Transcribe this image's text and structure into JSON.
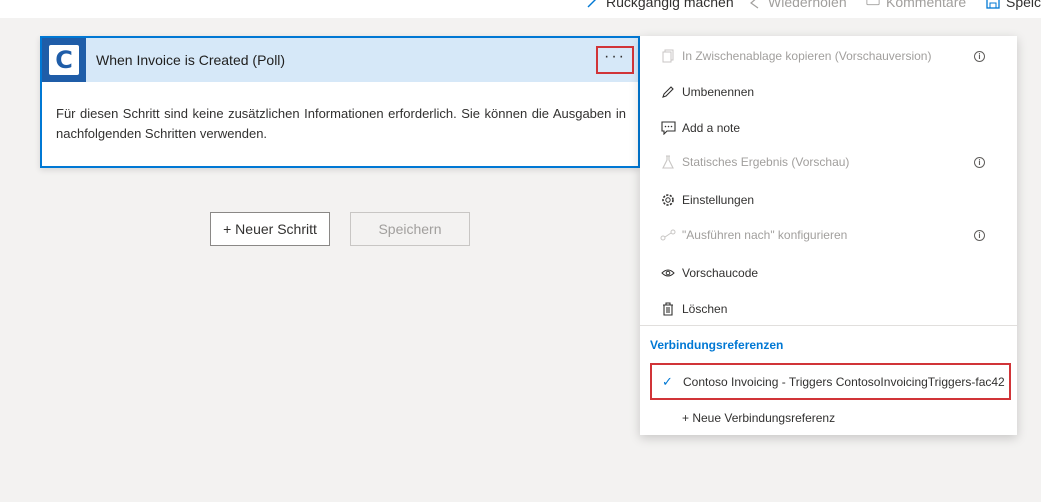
{
  "toolbar": {
    "undo_label": "Rückgängig machen",
    "redo_label": "Wiederholen",
    "comments_label": "Kommentare",
    "save_label": "Speichern",
    "undo_icon": "undo-arrow-icon",
    "redo_icon": "redo-arrow-icon",
    "comments_icon": "comment-icon",
    "save_icon": "save-disk-icon"
  },
  "card": {
    "logo_letter": "C",
    "title": "When Invoice is Created (Poll)",
    "more_label": "···",
    "body": "Für diesen Schritt sind keine zusätzlichen Informationen erforderlich. Sie können die Ausgaben in nachfolgenden Schritten verwenden."
  },
  "actions": {
    "new_step": "+ Neuer Schritt",
    "save": "Speichern"
  },
  "menu": {
    "items": [
      {
        "label": "In Zwischenablage kopieren (Vorschauversion)",
        "icon": "copy-icon",
        "disabled": true,
        "info": true
      },
      {
        "label": "Umbenennen",
        "icon": "pencil-icon",
        "disabled": false,
        "info": false
      },
      {
        "label": "Add a note",
        "icon": "note-icon",
        "disabled": false,
        "info": false
      },
      {
        "label": "Statisches Ergebnis (Vorschau)",
        "icon": "flask-icon",
        "disabled": true,
        "info": true
      },
      {
        "label": "Einstellungen",
        "icon": "gear-icon",
        "disabled": false,
        "info": false
      },
      {
        "label": "\"Ausführen nach\" konfigurieren",
        "icon": "run-after-icon",
        "disabled": true,
        "info": true
      },
      {
        "label": "Vorschaucode",
        "icon": "eye-icon",
        "disabled": false,
        "info": false
      },
      {
        "label": "Löschen",
        "icon": "trash-icon",
        "disabled": false,
        "info": false
      }
    ],
    "info_glyph": "i",
    "section_title": "Verbindungsreferenzen",
    "connection": "Contoso Invoicing - Triggers ContosoInvoicingTriggers-fac42",
    "new_connection": "+ Neue Verbindungsreferenz"
  },
  "colors": {
    "accent": "#0078d4",
    "highlight": "#d13438",
    "header_bg": "#d6e8f8",
    "logo_bg": "#1f5da8"
  }
}
